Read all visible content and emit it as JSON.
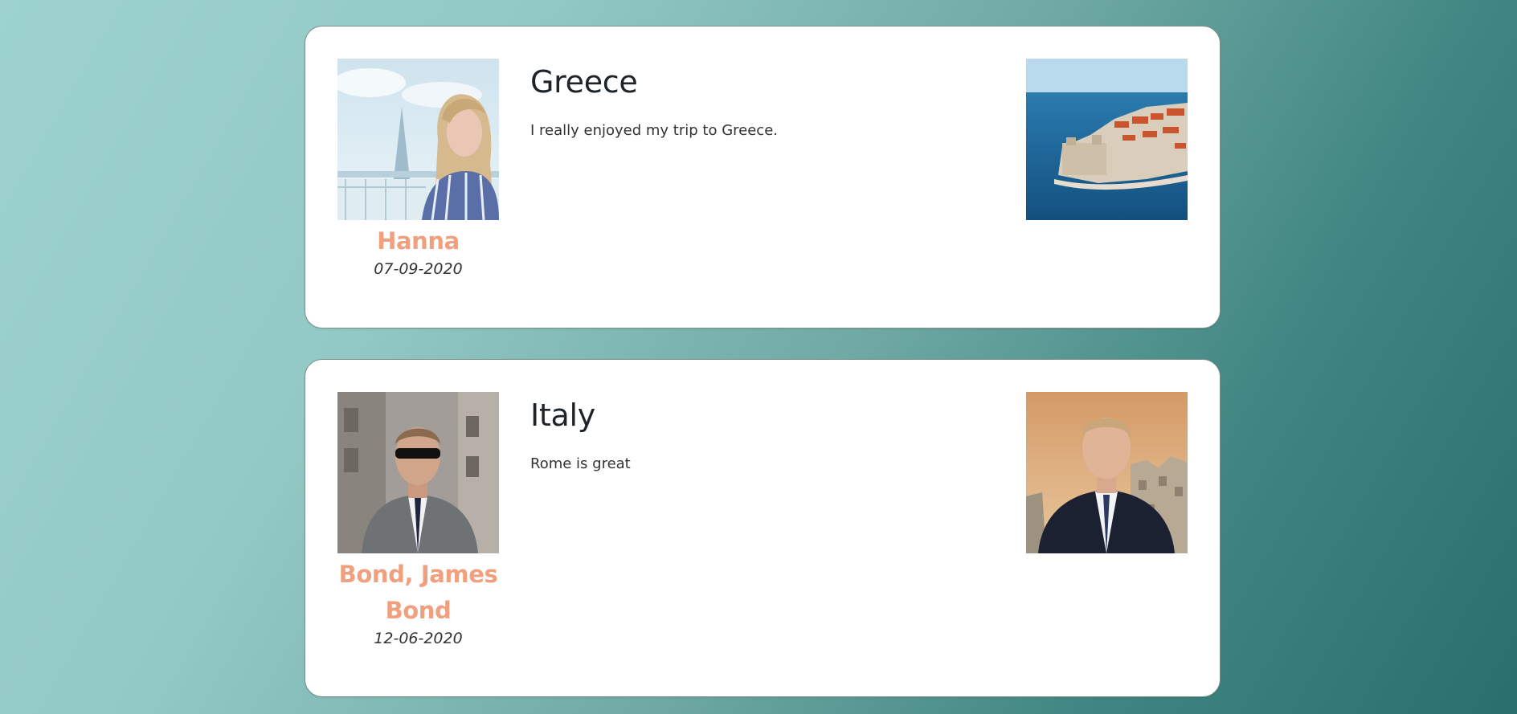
{
  "posts": [
    {
      "title": "Greece",
      "body": "I really enjoyed my trip to Greece.",
      "author": "Hanna",
      "date": "07-09-2020",
      "avatar_icon": "avatar-photo-woman",
      "image_icon": "photo-coastal-fortress"
    },
    {
      "title": "Italy",
      "body": "Rome is great",
      "author": "Bond, James Bond",
      "author_line_1": "Bond, James",
      "author_line_2": "Bond",
      "date": "12-06-2020",
      "avatar_icon": "avatar-photo-man-suit",
      "image_icon": "photo-man-in-suit-cityscape"
    }
  ],
  "colors": {
    "author_accent": "#f0a07f",
    "card_background": "#ffffff",
    "page_gradient_start": "#9dd2cf",
    "page_gradient_end": "#296f6b"
  }
}
